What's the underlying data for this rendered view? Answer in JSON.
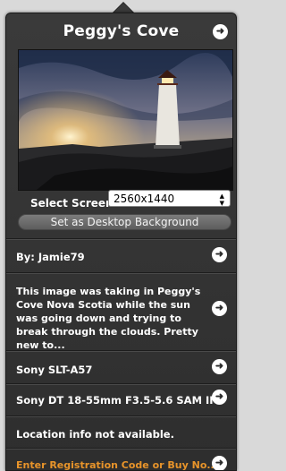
{
  "header": {
    "title": "Peggy's Cove"
  },
  "screen_select": {
    "label": "Select Screen",
    "value": "2560x1440",
    "updown_icon": "updown-icon"
  },
  "actions": {
    "set_desktop": "Set as Desktop Background"
  },
  "author": {
    "label": "By: Jamie79"
  },
  "description": {
    "text": "This image was taking in Peggy's Cove Nova Scotia while the sun was going down and trying to break through the clouds.  Pretty new to..."
  },
  "camera": {
    "model": "Sony SLT-A57"
  },
  "lens": {
    "model": "Sony DT 18-55mm F3.5-5.6 SAM II"
  },
  "location": {
    "text": "Location info not available."
  },
  "registration": {
    "text": "Enter Registration Code or Buy No..."
  },
  "colors": {
    "panel": "#333333",
    "accent": "#e8942a",
    "text": "#ffffff"
  }
}
